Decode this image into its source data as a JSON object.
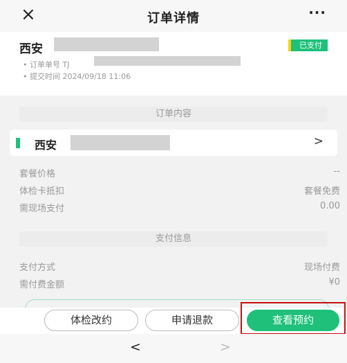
{
  "header": {
    "close_icon": "×",
    "title": "订单详情",
    "more_icon": "···"
  },
  "order": {
    "name_prefix": "西安",
    "status_badge": "已支付",
    "order_no_label": "• 订单单号 TJ",
    "submit_time": "• 提交时间 2024/09/18 11:06"
  },
  "content_section": {
    "title": "订单内容",
    "package_name": "西安",
    "arrow": ">"
  },
  "price_rows": [
    {
      "label": "套餐价格",
      "value": "--"
    },
    {
      "label": "体检卡抵扣",
      "value": "套餐免费"
    },
    {
      "label": "需现场支付",
      "value": "0.00"
    }
  ],
  "payment_section": {
    "title": "支付信息",
    "rows": [
      {
        "label": "支付方式",
        "value": "现场付费"
      },
      {
        "label": "需付费金额",
        "value": "¥0"
      }
    ]
  },
  "actions": {
    "change_label": "体检改约",
    "refund_label": "申请退款",
    "view_label": "查看预约"
  },
  "browser_nav": {
    "back": "<",
    "forward": ">"
  },
  "colors": {
    "accent": "#1ec07a",
    "badge_stripe": "#ffd400",
    "highlight_box": "#c41010"
  }
}
